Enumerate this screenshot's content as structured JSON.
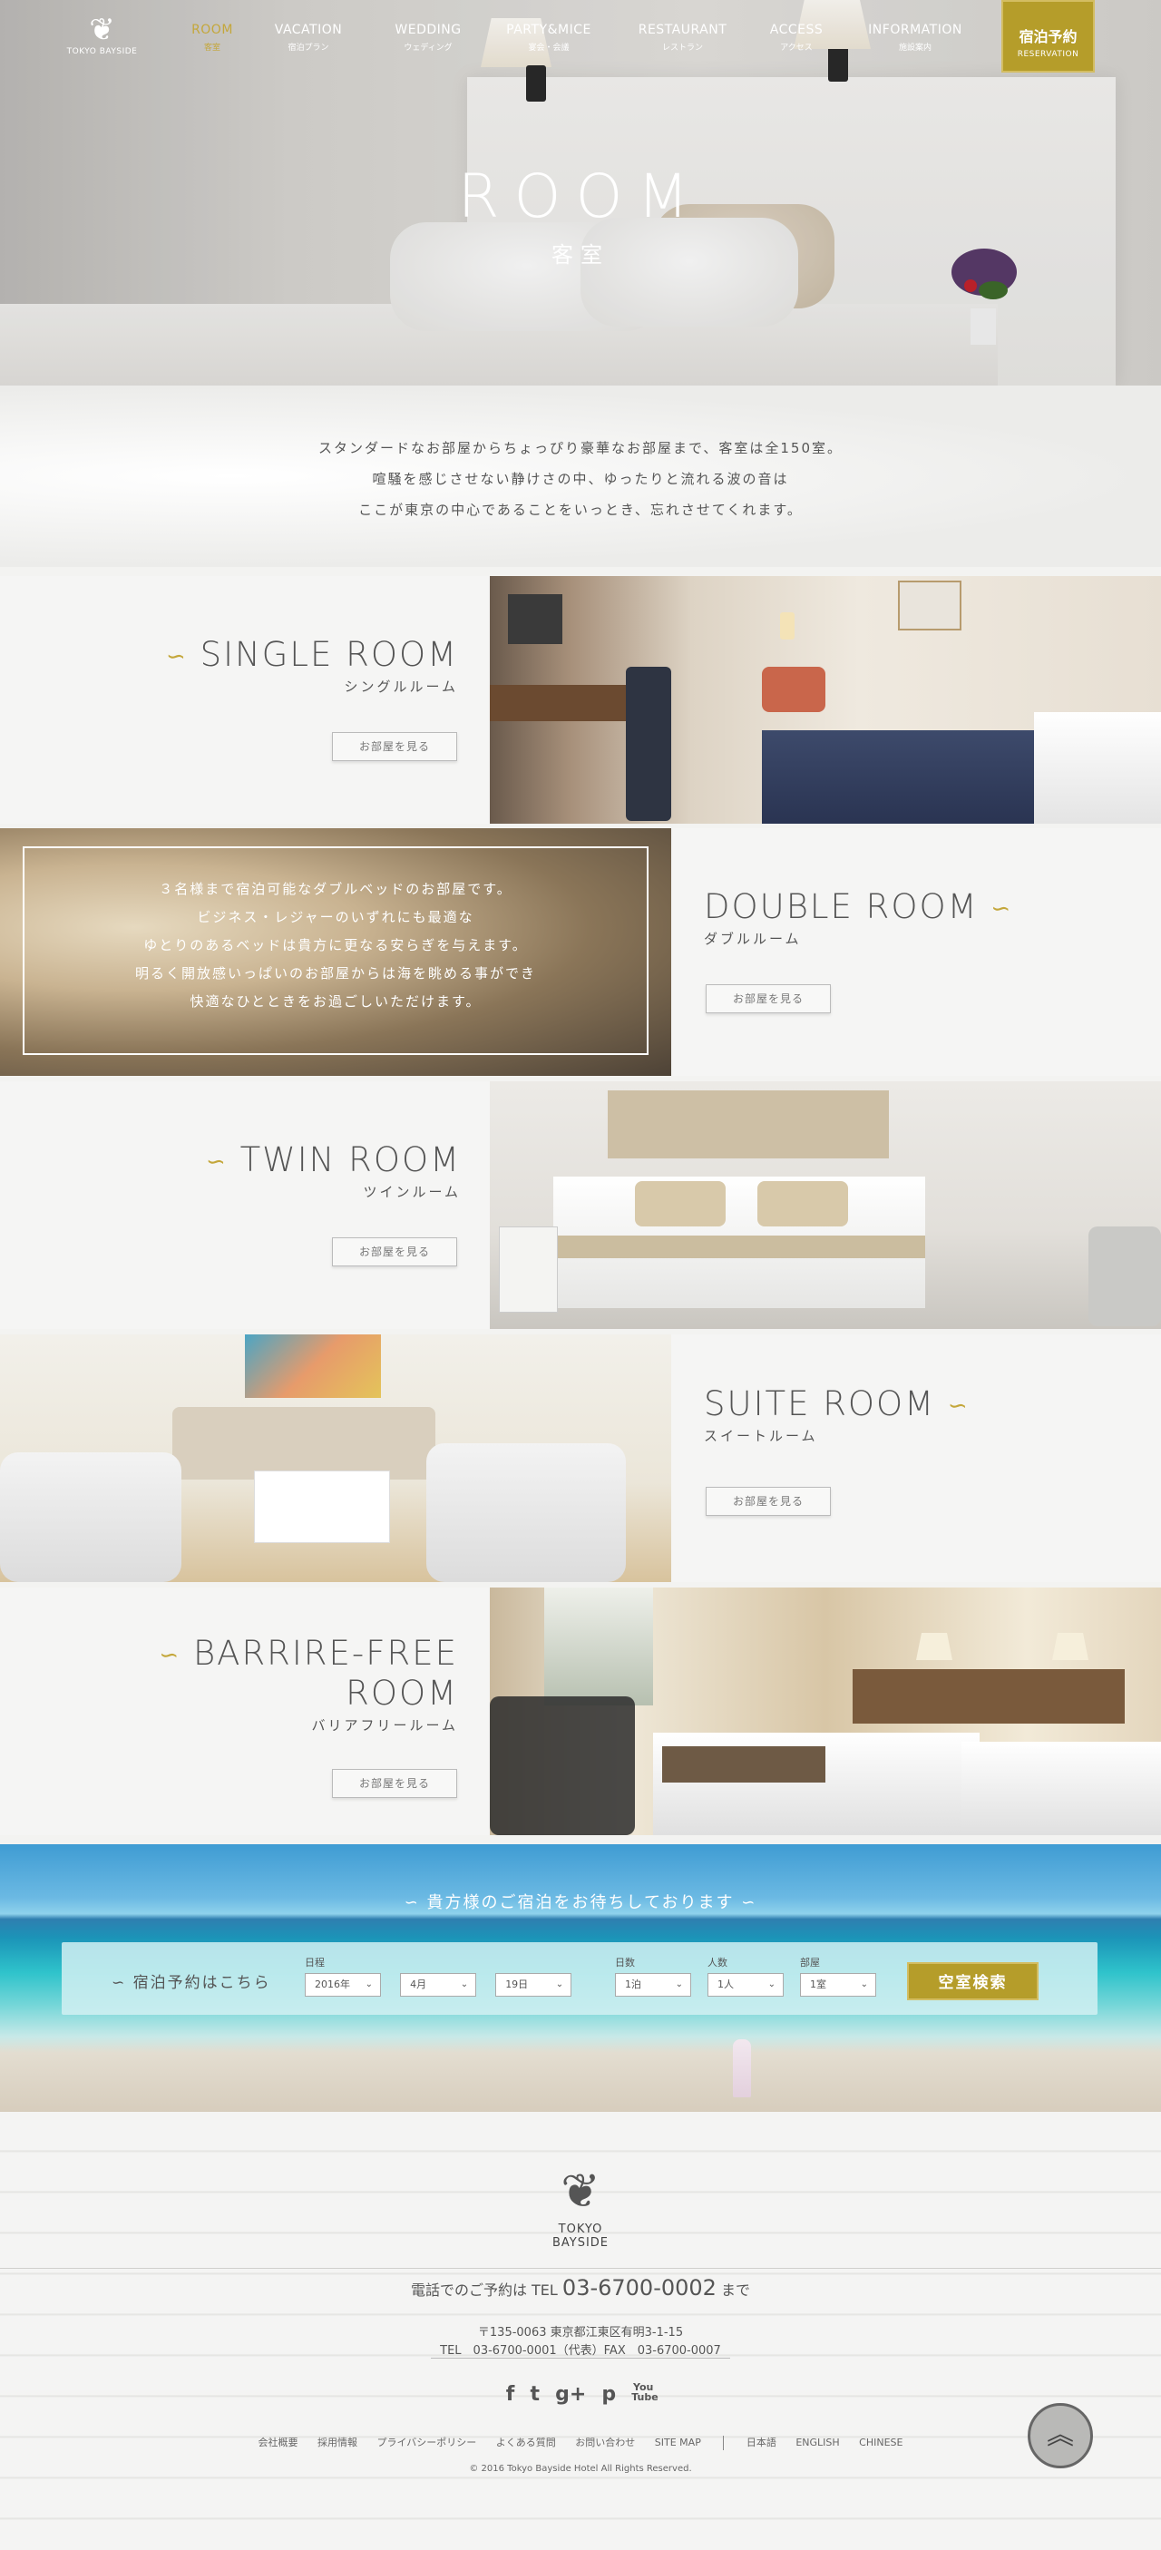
{
  "site": {
    "logo_text": "TOKYO BAYSIDE"
  },
  "nav": {
    "items": [
      {
        "en": "ROOM",
        "jp": "客室"
      },
      {
        "en": "VACATION",
        "jp": "宿泊プラン"
      },
      {
        "en": "WEDDING",
        "jp": "ウェディング"
      },
      {
        "en": "PARTY&MICE",
        "jp": "宴会・会議"
      },
      {
        "en": "RESTAURANT",
        "jp": "レストラン"
      },
      {
        "en": "ACCESS",
        "jp": "アクセス"
      },
      {
        "en": "INFORMATION",
        "jp": "施設案内"
      }
    ],
    "reserve_jp": "宿泊予約",
    "reserve_en": "RESERVATION"
  },
  "hero": {
    "title_en": "ROOM",
    "title_jp": "客室"
  },
  "intro": {
    "lines": [
      "スタンダードなお部屋からちょっぴり豪華なお部屋まで、客室は全150室。",
      "喧騒を感じさせない静けさの中、ゆったりと流れる波の音は",
      "ここが東京の中心であることをいっとき、忘れさせてくれます。"
    ]
  },
  "rooms": {
    "single": {
      "title": "SINGLE ROOM",
      "subtitle": "シングルルーム",
      "button": "お部屋を見る"
    },
    "double": {
      "title": "DOUBLE ROOM",
      "subtitle": "ダブルルーム",
      "button": "お部屋を見る",
      "description": [
        "３名様まで宿泊可能なダブルベッドのお部屋です。",
        "ビジネス・レジャーのいずれにも最適な",
        "ゆとりのあるベッドは貴方に更なる安らぎを与えます。",
        "明るく開放感いっぱいのお部屋からは海を眺める事ができ",
        "快適なひとときをお過ごしいただけます。"
      ]
    },
    "twin": {
      "title": "TWIN ROOM",
      "subtitle": "ツインルーム",
      "button": "お部屋を見る"
    },
    "suite": {
      "title": "SUITE ROOM",
      "subtitle": "スイートルーム",
      "button": "お部屋を見る"
    },
    "barrier": {
      "title_line1": "BARRIRE-FREE",
      "title_line2": "ROOM",
      "subtitle": "バリアフリールーム",
      "button": "お部屋を見る"
    }
  },
  "booking": {
    "headline": "貴方様のご宿泊をお待ちしております",
    "label": "宿泊予約はこちら",
    "date_label": "日程",
    "year": "2016年",
    "month": "4月",
    "day": "19日",
    "nights_label": "日数",
    "nights": "1泊",
    "people_label": "人数",
    "people": "1人",
    "rooms_label": "部屋",
    "rooms": "1室",
    "search_button": "空室検索"
  },
  "footer": {
    "logo_text": "TOKYO BAYSIDE",
    "tel_prefix": "電話でのご予約は TEL",
    "tel_number": "03-6700-0002",
    "tel_suffix": "まで",
    "address": "〒135-0063 東京都江東区有明3-1-15",
    "tel_fax": "TEL　03-6700-0001（代表）FAX　03-6700-0007",
    "social": [
      "f",
      "t",
      "g+",
      "p",
      "You Tube"
    ],
    "links": [
      "会社概要",
      "採用情報",
      "プライバシーポリシー",
      "よくある質問",
      "お問い合わせ",
      "SITE MAP"
    ],
    "languages": [
      "日本語",
      "ENGLISH",
      "CHINESE"
    ],
    "copyright": "© 2016 Tokyo Bayside Hotel All Rights Reserved.",
    "pagetop": "︽"
  },
  "colors": {
    "accent": "#b59d2a",
    "nav_active": "#c4a73b"
  }
}
